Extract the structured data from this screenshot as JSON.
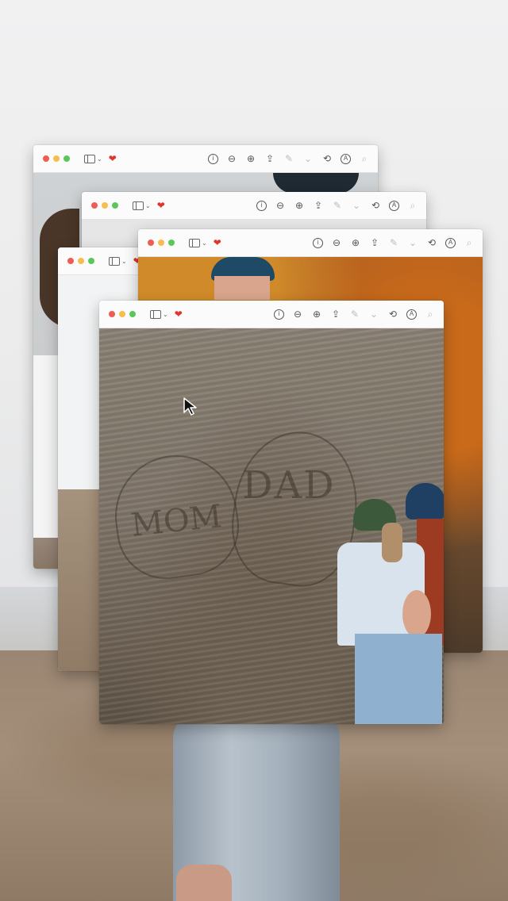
{
  "windows": [
    {
      "name": "preview-window-back",
      "favorite_icon": "heart-icon"
    },
    {
      "name": "preview-window-2",
      "favorite_icon": "heart-icon"
    },
    {
      "name": "preview-window-3",
      "favorite_icon": "heart-icon"
    },
    {
      "name": "preview-window-4",
      "favorite_icon": "heart-icon"
    },
    {
      "name": "preview-window-front",
      "favorite_icon": "heart-icon"
    }
  ],
  "toolbar": {
    "favorite_glyph": "❤",
    "tools": [
      {
        "icon": "info-icon",
        "glyph": "i"
      },
      {
        "icon": "zoom-out-icon",
        "glyph": "⊖"
      },
      {
        "icon": "zoom-in-icon",
        "glyph": "⊕"
      },
      {
        "icon": "share-icon",
        "glyph": "⇪"
      },
      {
        "icon": "markup-pen-icon",
        "glyph": "✎"
      },
      {
        "icon": "chevron-down-icon",
        "glyph": "⌄"
      },
      {
        "icon": "rotate-icon",
        "glyph": "⟲"
      },
      {
        "icon": "annotate-icon",
        "glyph": "A"
      },
      {
        "icon": "search-icon",
        "glyph": "⌕"
      }
    ]
  },
  "photo": {
    "carving_dad": "DAD",
    "carving_mom": "MOM"
  },
  "colors": {
    "close": "#ee5c54",
    "minimize": "#f6be4f",
    "maximize": "#5bc75a",
    "heart": "#e0342e"
  }
}
